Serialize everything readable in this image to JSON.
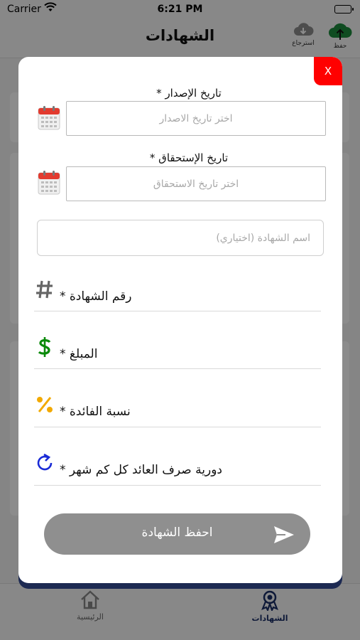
{
  "status_bar": {
    "carrier": "Carrier",
    "time": "6:21 PM"
  },
  "nav": {
    "title": "الشهادات",
    "save_label": "حفظ",
    "restore_label": "استرجاع"
  },
  "tabs": [
    {
      "label": "الرئيسية"
    },
    {
      "label": "الشهادات"
    }
  ],
  "modal": {
    "close_label": "X",
    "issue_date": {
      "label": "تاريخ الإصدار *",
      "placeholder": "اختر تاريخ الاصدار"
    },
    "maturity_date": {
      "label": "تاريخ الإستحقاق *",
      "placeholder": "اختر تاريخ الاستحقاق"
    },
    "certificate_name": {
      "placeholder": "اسم الشهادة (اختياري)"
    },
    "certificate_number": {
      "label": "رقم الشهادة *"
    },
    "amount": {
      "label": "المبلغ *"
    },
    "interest_rate": {
      "label": "نسبة الفائدة *"
    },
    "payout_period": {
      "label": "دورية صرف العائد كل كم شهر *"
    },
    "save_button": "احفظ الشهادة"
  },
  "colors": {
    "close_button": "#ff0000",
    "dollar_icon": "#0a8a0a",
    "percent_icon": "#f2a900",
    "refresh_icon": "#1a2bd6",
    "hash_icon": "#666666",
    "save_button": "#8f8f8f",
    "cloud_save": "#1d8a3c",
    "cloud_restore": "#8c8c8c"
  }
}
